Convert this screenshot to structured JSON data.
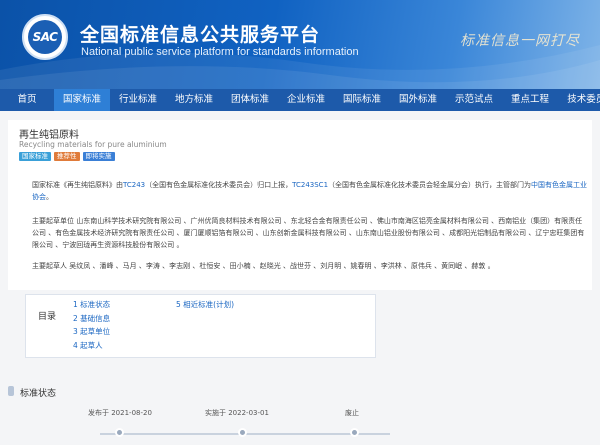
{
  "header": {
    "logo_text": "SAC",
    "title": "全国标准信息公共服务平台",
    "subtitle": "National public service platform  for standards information",
    "slogan": "标准信息一网打尽"
  },
  "nav": [
    {
      "label": "首页"
    },
    {
      "label": "国家标准",
      "active": true
    },
    {
      "label": "行业标准"
    },
    {
      "label": "地方标准"
    },
    {
      "label": "团体标准"
    },
    {
      "label": "企业标准"
    },
    {
      "label": "国际标准"
    },
    {
      "label": "国外标准"
    },
    {
      "label": "示范试点"
    },
    {
      "label": "重点工程"
    },
    {
      "label": "技术委员会"
    }
  ],
  "standard": {
    "title": "再生纯铝原料",
    "title_en": "Recycling materials for pure aluminium",
    "tags": [
      {
        "label": "国家标准",
        "color": "#3aa0d8"
      },
      {
        "label": "推荐性",
        "color": "#e07b3a"
      },
      {
        "label": "即将实施",
        "color": "#3a7fd6"
      }
    ],
    "para1_pre": "国家标准《再生纯铝原料》由",
    "tc_code": "TC243",
    "para1_mid": "（全国有色金属标准化技术委员会）归口上报，",
    "sc_code": "TC243SC1",
    "para1_mid2": "（全国有色金属标准化技术委员会轻金属分会）执行，主管部门为",
    "department": "中国有色金属工业协会",
    "para1_end": "。",
    "drafting_units": "主要起草单位 山东南山科学技术研究院有限公司 、广州优简良材料技术有限公司 、东北轻合金有限责任公司 、佛山市南海区铝亮金属材料有限公司 、西南铝业（集团）有限责任公司 、有色金属技术经济研究院有限责任公司 、厦门厦顺铝箔有限公司 、山东创新金属科技有限公司 、山东南山铝业股份有限公司 、成都阳光铝制品有限公司 、辽宁忠旺集团有限公司 、宁波回珑再生资源科技股份有限公司 。",
    "drafters": "主要起草人 吴纹凤 、潘峰 、马月 、李涛 、李志刚 、杜恒安 、田小楠 、赵晓光 、战世芬 、刘月明 、姚春明 、李洪林 、原伟兵 、黄同岷 、赫敦 。"
  },
  "toc": {
    "label": "目录",
    "col1": [
      "1  标准状态",
      "2  基础信息",
      "3  起草单位",
      "4  起草人"
    ],
    "col2": [
      "5  相近标准(计划)"
    ]
  },
  "status": {
    "title": "标准状态",
    "items": [
      {
        "label": "发布于 2021-08-20"
      },
      {
        "label": "实施于 2022-03-01"
      },
      {
        "label": "废止"
      }
    ]
  }
}
